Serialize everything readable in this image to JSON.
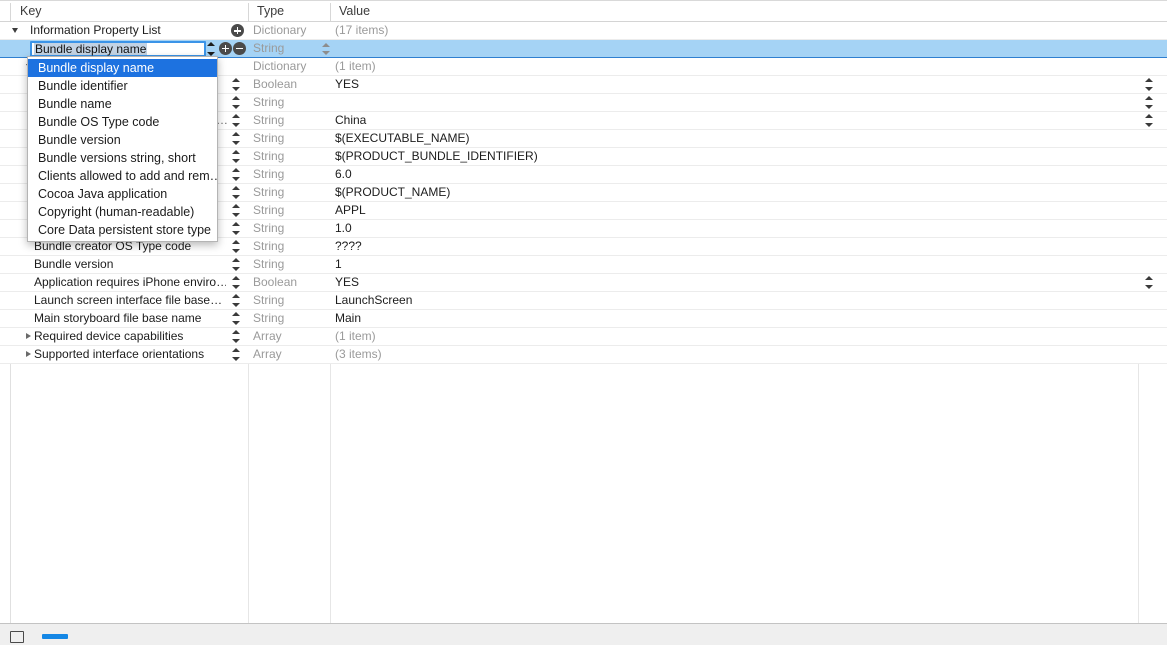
{
  "header": {
    "columns": [
      "Key",
      "Type",
      "Value"
    ]
  },
  "edit_field": {
    "value": "Bundle display name",
    "placeholder": "Key",
    "add_label": "+",
    "remove_label": "−"
  },
  "dropdown": {
    "selected": "Bundle display name",
    "items": [
      "Bundle display name",
      "Bundle identifier",
      "Bundle name",
      "Bundle OS Type code",
      "Bundle version",
      "Bundle versions string, short",
      "Clients allowed to add and rem…",
      "Cocoa Java application",
      "Copyright (human-readable)",
      "Core Data persistent store type"
    ]
  },
  "rows": [
    {
      "key": "Information Property List",
      "type": "Dictionary",
      "value": "(17 items)",
      "value_muted": true,
      "disclosure": "down",
      "indent": 0,
      "add_button": true,
      "stepper": false,
      "right_stepper": false,
      "ellipsis": false,
      "selected": false
    },
    {
      "key": "Bundle display name",
      "type": "String",
      "value": "",
      "value_muted": false,
      "disclosure": "none",
      "indent": 1,
      "add_button": false,
      "stepper": false,
      "right_stepper": false,
      "ellipsis": false,
      "selected": true,
      "editing": true,
      "type_chevron": true
    },
    {
      "key": "",
      "type": "Dictionary",
      "value": "(1 item)",
      "value_muted": true,
      "disclosure": "down",
      "indent": 1,
      "add_button": false,
      "stepper": false,
      "right_stepper": false,
      "ellipsis": false,
      "selected": false
    },
    {
      "key": "",
      "type": "Boolean",
      "value": "YES",
      "value_muted": false,
      "disclosure": "none",
      "indent": 1,
      "add_button": false,
      "stepper": true,
      "right_stepper": true,
      "ellipsis": false,
      "selected": false
    },
    {
      "key": "",
      "type": "String",
      "value": "",
      "value_muted": false,
      "disclosure": "none",
      "indent": 1,
      "add_button": false,
      "stepper": true,
      "right_stepper": true,
      "ellipsis": false,
      "selected": false
    },
    {
      "key": "",
      "type": "String",
      "value": "China",
      "value_muted": false,
      "disclosure": "none",
      "indent": 1,
      "add_button": false,
      "stepper": true,
      "right_stepper": true,
      "ellipsis": true,
      "selected": false
    },
    {
      "key": "",
      "type": "String",
      "value": "$(EXECUTABLE_NAME)",
      "value_muted": false,
      "disclosure": "none",
      "indent": 1,
      "add_button": false,
      "stepper": true,
      "right_stepper": false,
      "ellipsis": false,
      "selected": false
    },
    {
      "key": "",
      "type": "String",
      "value": "$(PRODUCT_BUNDLE_IDENTIFIER)",
      "value_muted": false,
      "disclosure": "none",
      "indent": 1,
      "add_button": false,
      "stepper": true,
      "right_stepper": false,
      "ellipsis": false,
      "selected": false
    },
    {
      "key": "",
      "type": "String",
      "value": "6.0",
      "value_muted": false,
      "disclosure": "none",
      "indent": 1,
      "add_button": false,
      "stepper": true,
      "right_stepper": false,
      "ellipsis": false,
      "selected": false
    },
    {
      "key": "",
      "type": "String",
      "value": "$(PRODUCT_NAME)",
      "value_muted": false,
      "disclosure": "none",
      "indent": 1,
      "add_button": false,
      "stepper": true,
      "right_stepper": false,
      "ellipsis": false,
      "selected": false
    },
    {
      "key": "",
      "type": "String",
      "value": "APPL",
      "value_muted": false,
      "disclosure": "none",
      "indent": 1,
      "add_button": false,
      "stepper": true,
      "right_stepper": false,
      "ellipsis": false,
      "selected": false
    },
    {
      "key": "",
      "type": "String",
      "value": "1.0",
      "value_muted": false,
      "disclosure": "none",
      "indent": 1,
      "add_button": false,
      "stepper": true,
      "right_stepper": false,
      "ellipsis": false,
      "selected": false
    },
    {
      "key": "Bundle creator OS Type code",
      "type": "String",
      "value": "????",
      "value_muted": false,
      "disclosure": "none",
      "indent": 1,
      "add_button": false,
      "stepper": true,
      "right_stepper": false,
      "ellipsis": false,
      "selected": false
    },
    {
      "key": "Bundle version",
      "type": "String",
      "value": "1",
      "value_muted": false,
      "disclosure": "none",
      "indent": 1,
      "add_button": false,
      "stepper": true,
      "right_stepper": false,
      "ellipsis": false,
      "selected": false
    },
    {
      "key": "Application requires iPhone enviro…",
      "type": "Boolean",
      "value": "YES",
      "value_muted": false,
      "disclosure": "none",
      "indent": 1,
      "add_button": false,
      "stepper": true,
      "right_stepper": true,
      "ellipsis": false,
      "selected": false
    },
    {
      "key": "Launch screen interface file base…",
      "type": "String",
      "value": "LaunchScreen",
      "value_muted": false,
      "disclosure": "none",
      "indent": 1,
      "add_button": false,
      "stepper": true,
      "right_stepper": false,
      "ellipsis": false,
      "selected": false
    },
    {
      "key": "Main storyboard file base name",
      "type": "String",
      "value": "Main",
      "value_muted": false,
      "disclosure": "none",
      "indent": 1,
      "add_button": false,
      "stepper": true,
      "right_stepper": false,
      "ellipsis": false,
      "selected": false
    },
    {
      "key": "Required device capabilities",
      "type": "Array",
      "value": "(1 item)",
      "value_muted": true,
      "disclosure": "right",
      "indent": 1,
      "add_button": false,
      "stepper": true,
      "right_stepper": false,
      "ellipsis": false,
      "selected": false
    },
    {
      "key": "Supported interface orientations",
      "type": "Array",
      "value": "(3 items)",
      "value_muted": true,
      "disclosure": "right",
      "indent": 1,
      "add_button": false,
      "stepper": true,
      "right_stepper": false,
      "ellipsis": false,
      "selected": false
    }
  ],
  "bottom_bar": {
    "editor_toggle": "editor-toggle",
    "view_toggle": "view-toggle"
  },
  "colors": {
    "selection_blue": "#a5d3f5",
    "selection_border": "#2f7fd0",
    "menu_highlight": "#1d72e0",
    "focus_ring": "#3b94e8",
    "muted_text": "#9a9a9a",
    "bottom_accent": "#1587e5"
  }
}
